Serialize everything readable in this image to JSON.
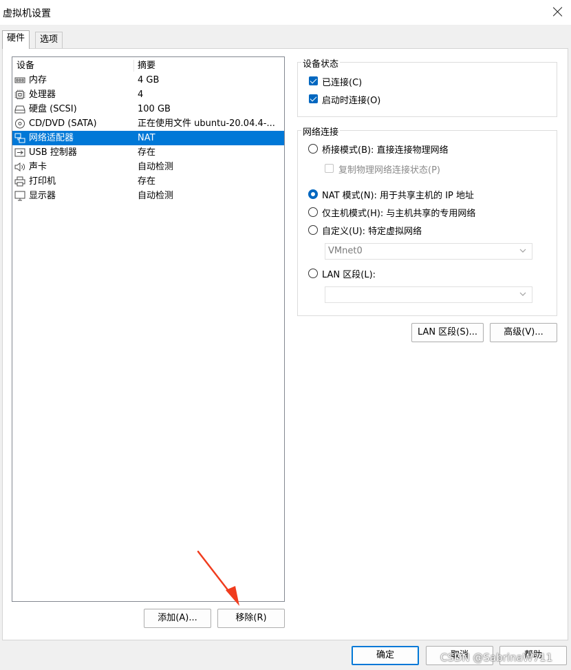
{
  "window": {
    "title": "虚拟机设置"
  },
  "tabs": [
    {
      "label": "硬件"
    },
    {
      "label": "选项"
    }
  ],
  "device_list": {
    "headers": {
      "device": "设备",
      "summary": "摘要"
    },
    "rows": [
      {
        "name": "内存",
        "summary": "4 GB",
        "icon": "memory-icon"
      },
      {
        "name": "处理器",
        "summary": "4",
        "icon": "cpu-icon"
      },
      {
        "name": "硬盘 (SCSI)",
        "summary": "100 GB",
        "icon": "harddisk-icon"
      },
      {
        "name": "CD/DVD (SATA)",
        "summary": "正在使用文件 ubuntu-20.04.4-...",
        "icon": "cd-icon"
      },
      {
        "name": "网络适配器",
        "summary": "NAT",
        "icon": "network-icon",
        "selected": true
      },
      {
        "name": "USB 控制器",
        "summary": "存在",
        "icon": "usb-icon"
      },
      {
        "name": "声卡",
        "summary": "自动检测",
        "icon": "speaker-icon"
      },
      {
        "name": "打印机",
        "summary": "存在",
        "icon": "printer-icon"
      },
      {
        "name": "显示器",
        "summary": "自动检测",
        "icon": "monitor-icon"
      }
    ]
  },
  "device_status": {
    "title": "设备状态",
    "connected": "已连接(C)",
    "connect_on_start": "启动时连接(O)"
  },
  "network_connection": {
    "title": "网络连接",
    "bridged": "桥接模式(B): 直接连接物理网络",
    "replicate": "复制物理网络连接状态(P)",
    "nat": "NAT 模式(N): 用于共享主机的 IP 地址",
    "host_only": "仅主机模式(H): 与主机共享的专用网络",
    "custom": "自定义(U): 特定虚拟网络",
    "custom_value": "VMnet0",
    "lan_segment": "LAN 区段(L):",
    "lan_value": ""
  },
  "buttons": {
    "lan_segments": "LAN 区段(S)...",
    "advanced": "高级(V)...",
    "add": "添加(A)...",
    "remove": "移除(R)",
    "ok": "确定",
    "cancel": "取消",
    "help": "帮助"
  },
  "watermark": "CSDN @SabrinaW711",
  "colors": {
    "selection": "#0078d7",
    "accent": "#0067c0",
    "arrow": "#f03c1e"
  }
}
